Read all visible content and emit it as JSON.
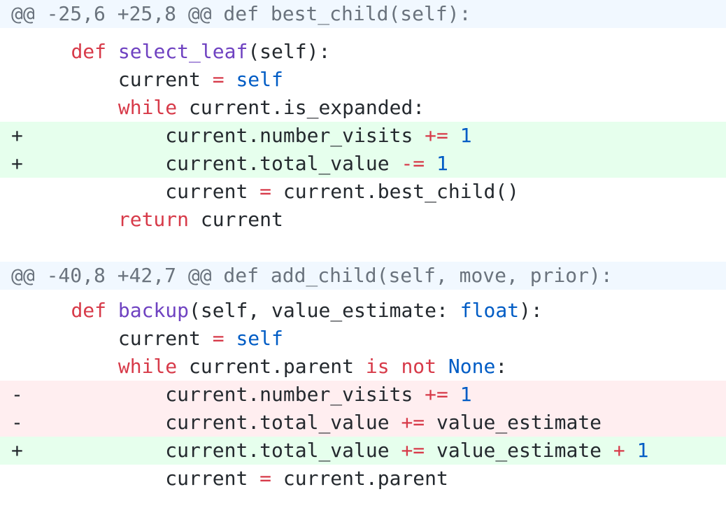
{
  "hunks": [
    {
      "header": "@@ -25,6 +25,8 @@ def best_child(self):",
      "lines": [
        {
          "type": "context",
          "marker": "",
          "indent": "    ",
          "tokens": [
            {
              "t": "kw",
              "s": "def"
            },
            {
              "t": "tx",
              "s": " "
            },
            {
              "t": "fn",
              "s": "select_leaf"
            },
            {
              "t": "tx",
              "s": "(self):"
            }
          ]
        },
        {
          "type": "context",
          "marker": "",
          "indent": "        ",
          "tokens": [
            {
              "t": "tx",
              "s": "current "
            },
            {
              "t": "op",
              "s": "="
            },
            {
              "t": "tx",
              "s": " "
            },
            {
              "t": "bi",
              "s": "self"
            }
          ]
        },
        {
          "type": "context",
          "marker": "",
          "indent": "        ",
          "tokens": [
            {
              "t": "kw",
              "s": "while"
            },
            {
              "t": "tx",
              "s": " current.is_expanded:"
            }
          ]
        },
        {
          "type": "add",
          "marker": "+",
          "indent": "            ",
          "tokens": [
            {
              "t": "tx",
              "s": "current.number_visits "
            },
            {
              "t": "op",
              "s": "+="
            },
            {
              "t": "tx",
              "s": " "
            },
            {
              "t": "num",
              "s": "1"
            }
          ]
        },
        {
          "type": "add",
          "marker": "+",
          "indent": "            ",
          "tokens": [
            {
              "t": "tx",
              "s": "current.total_value "
            },
            {
              "t": "op",
              "s": "-="
            },
            {
              "t": "tx",
              "s": " "
            },
            {
              "t": "num",
              "s": "1"
            }
          ]
        },
        {
          "type": "context",
          "marker": "",
          "indent": "            ",
          "tokens": [
            {
              "t": "tx",
              "s": "current "
            },
            {
              "t": "op",
              "s": "="
            },
            {
              "t": "tx",
              "s": " current.best_child()"
            }
          ]
        },
        {
          "type": "context",
          "marker": "",
          "indent": "        ",
          "tokens": [
            {
              "t": "kw",
              "s": "return"
            },
            {
              "t": "tx",
              "s": " current"
            }
          ]
        },
        {
          "type": "context",
          "marker": "",
          "indent": "",
          "tokens": []
        }
      ]
    },
    {
      "header": "@@ -40,8 +42,7 @@ def add_child(self, move, prior):",
      "lines": [
        {
          "type": "context",
          "marker": "",
          "indent": "    ",
          "tokens": [
            {
              "t": "kw",
              "s": "def"
            },
            {
              "t": "tx",
              "s": " "
            },
            {
              "t": "fn",
              "s": "backup"
            },
            {
              "t": "tx",
              "s": "(self, value_estimate: "
            },
            {
              "t": "bi",
              "s": "float"
            },
            {
              "t": "tx",
              "s": "):"
            }
          ]
        },
        {
          "type": "context",
          "marker": "",
          "indent": "        ",
          "tokens": [
            {
              "t": "tx",
              "s": "current "
            },
            {
              "t": "op",
              "s": "="
            },
            {
              "t": "tx",
              "s": " "
            },
            {
              "t": "bi",
              "s": "self"
            }
          ]
        },
        {
          "type": "context",
          "marker": "",
          "indent": "        ",
          "tokens": [
            {
              "t": "kw",
              "s": "while"
            },
            {
              "t": "tx",
              "s": " current.parent "
            },
            {
              "t": "kw",
              "s": "is"
            },
            {
              "t": "tx",
              "s": " "
            },
            {
              "t": "kw",
              "s": "not"
            },
            {
              "t": "tx",
              "s": " "
            },
            {
              "t": "bi",
              "s": "None"
            },
            {
              "t": "tx",
              "s": ":"
            }
          ]
        },
        {
          "type": "del",
          "marker": "-",
          "indent": "            ",
          "tokens": [
            {
              "t": "tx",
              "s": "current.number_visits "
            },
            {
              "t": "op",
              "s": "+="
            },
            {
              "t": "tx",
              "s": " "
            },
            {
              "t": "num",
              "s": "1"
            }
          ]
        },
        {
          "type": "del",
          "marker": "-",
          "indent": "            ",
          "tokens": [
            {
              "t": "tx",
              "s": "current.total_value "
            },
            {
              "t": "op",
              "s": "+="
            },
            {
              "t": "tx",
              "s": " value_estimate"
            }
          ]
        },
        {
          "type": "add",
          "marker": "+",
          "indent": "            ",
          "tokens": [
            {
              "t": "tx",
              "s": "current.total_value "
            },
            {
              "t": "op",
              "s": "+="
            },
            {
              "t": "tx",
              "s": " value_estimate "
            },
            {
              "t": "op",
              "s": "+"
            },
            {
              "t": "tx",
              "s": " "
            },
            {
              "t": "num",
              "s": "1"
            }
          ]
        },
        {
          "type": "context",
          "marker": "",
          "indent": "            ",
          "tokens": [
            {
              "t": "tx",
              "s": "current "
            },
            {
              "t": "op",
              "s": "="
            },
            {
              "t": "tx",
              "s": " current.parent"
            }
          ]
        }
      ]
    }
  ]
}
